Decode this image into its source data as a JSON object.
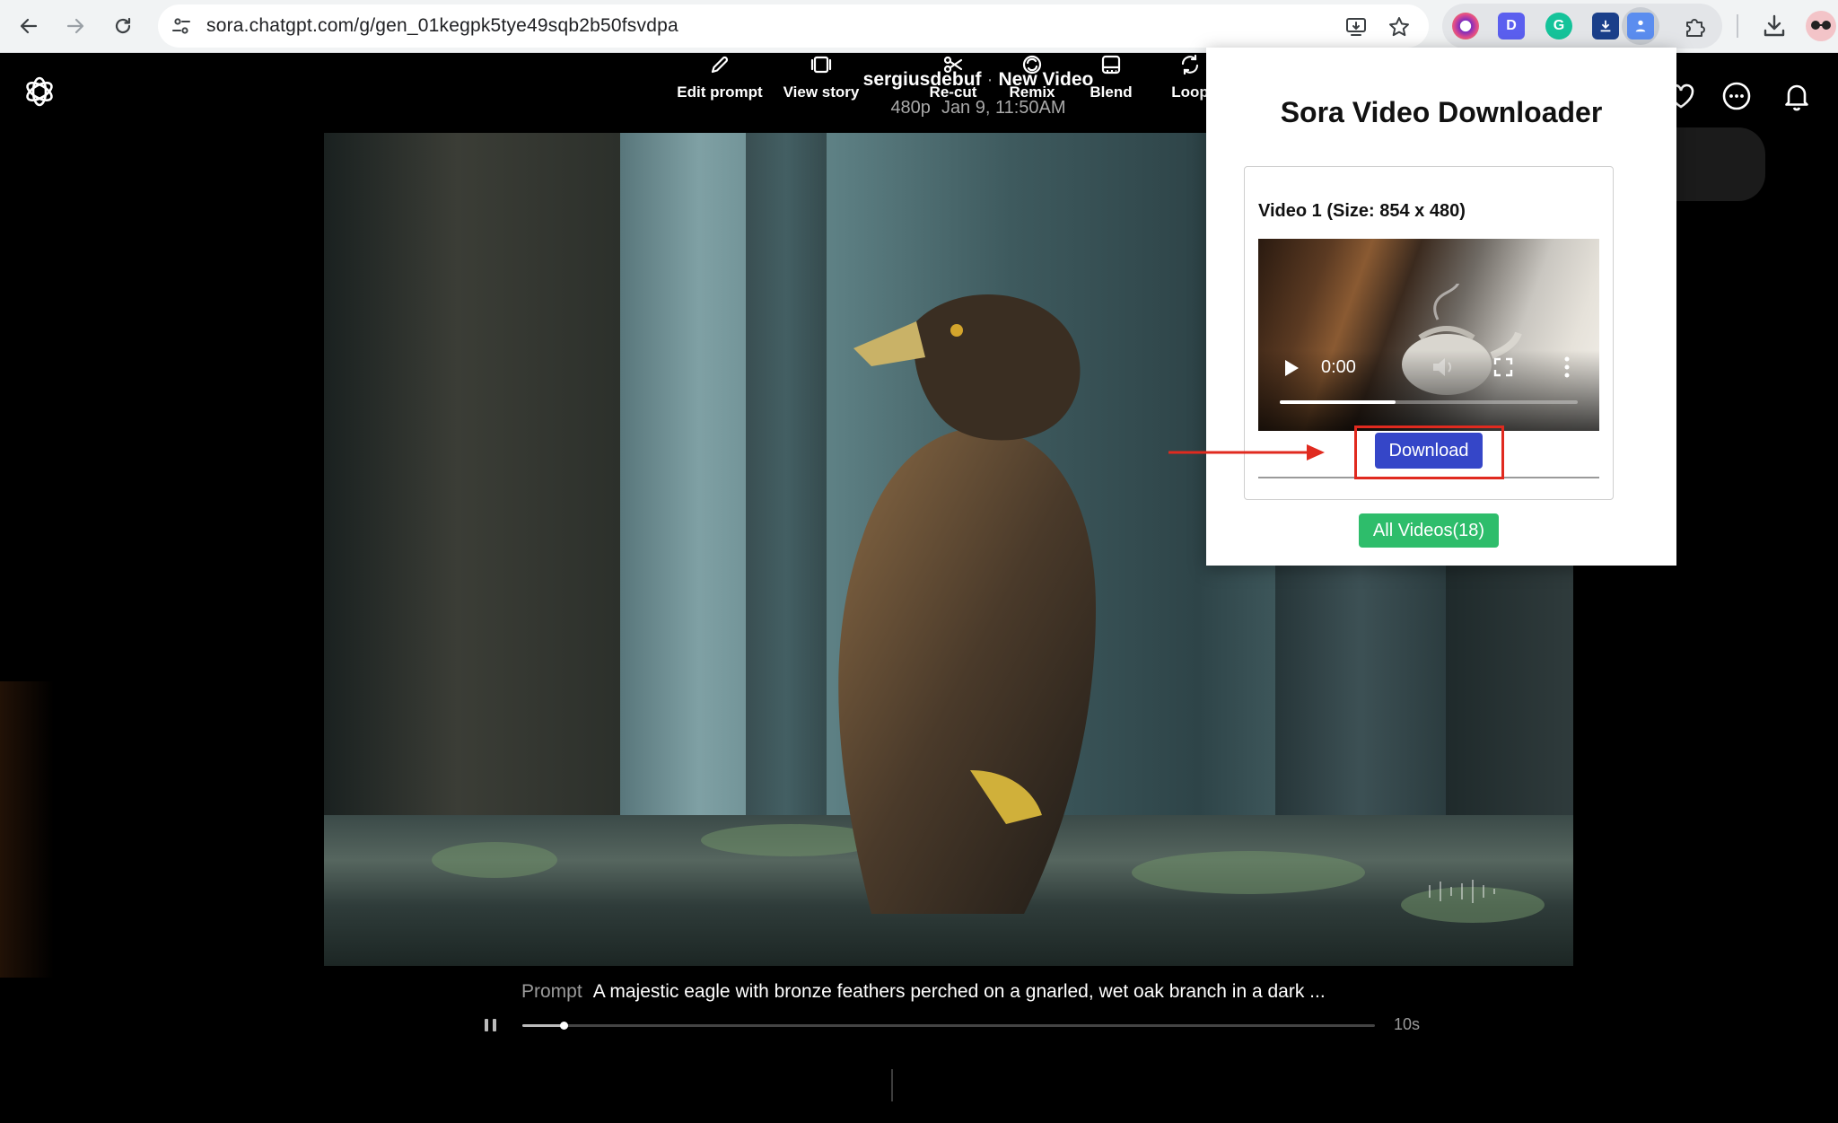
{
  "browser": {
    "url": "sora.chatgpt.com/g/gen_01kegpk5tye49sqb2b50fsvdpa",
    "extensions": [
      {
        "name": "chrome-icon",
        "color": "#7b2cbf"
      },
      {
        "name": "d-icon",
        "color": "#5b5fef",
        "letter": "D"
      },
      {
        "name": "grammarly-icon",
        "color": "#15c39a",
        "letter": "G"
      },
      {
        "name": "downloader-icon",
        "color": "#1a3f8a"
      },
      {
        "name": "sora-downloader-icon",
        "color": "#5b8def"
      }
    ]
  },
  "header": {
    "author": "sergiusdebuf",
    "separator": "·",
    "title": "New Video",
    "resolution": "480p",
    "date": "Jan 9, 11:50AM"
  },
  "prompt": {
    "label": "Prompt",
    "text": "A majestic eagle with bronze feathers perched on a gnarled, wet oak branch in a dark ..."
  },
  "playback": {
    "progress": 0.048,
    "duration": "10s"
  },
  "toolbar": [
    {
      "name": "edit-prompt",
      "label": "Edit prompt",
      "icon": "pencil-icon"
    },
    {
      "name": "view-story",
      "label": "View story",
      "icon": "story-icon"
    },
    {
      "name": "re-cut",
      "label": "Re-cut",
      "icon": "scissors-icon"
    },
    {
      "name": "remix",
      "label": "Remix",
      "icon": "remix-icon"
    },
    {
      "name": "blend",
      "label": "Blend",
      "icon": "blend-icon"
    },
    {
      "name": "loop",
      "label": "Loop",
      "icon": "loop-icon"
    }
  ],
  "popup": {
    "title": "Sora Video Downloader",
    "video_label": "Video 1  (Size: 854 x 480)",
    "player_time": "0:00",
    "player_progress": 0.39,
    "download_label": "Download",
    "all_videos_label": "All Videos(18)"
  },
  "colors": {
    "download_button": "#3546c8",
    "all_videos_button": "#2ebd6b",
    "highlight": "#e02a1f"
  }
}
